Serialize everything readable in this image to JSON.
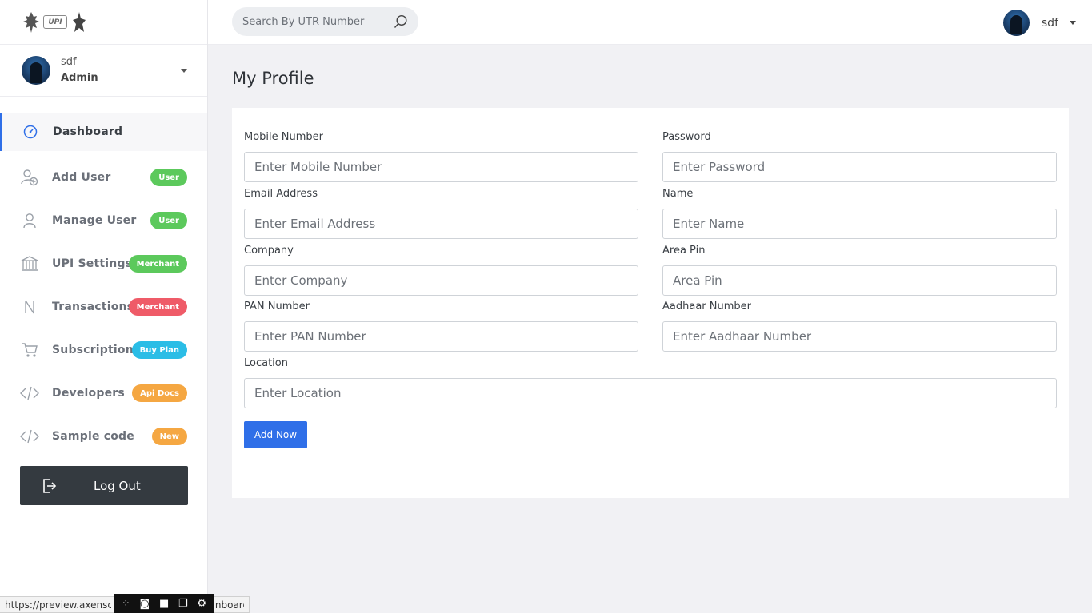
{
  "sidebar": {
    "user": {
      "name": "sdf",
      "role": "Admin"
    },
    "items": [
      {
        "label": "Dashboard",
        "icon": "gauge-icon",
        "badge": "",
        "badge_color": ""
      },
      {
        "label": "Add User",
        "icon": "add-user-icon",
        "badge": "User",
        "badge_color": "#5cc95c"
      },
      {
        "label": "Manage User",
        "icon": "user-icon",
        "badge": "User",
        "badge_color": "#5cc95c"
      },
      {
        "label": "UPI Settings",
        "icon": "bank-icon",
        "badge": "Merchant",
        "badge_color": "#5cc95c"
      },
      {
        "label": "Transactions",
        "icon": "rupee-icon",
        "badge": "Merchant",
        "badge_color": "#ef5b68"
      },
      {
        "label": "Subscription",
        "icon": "cart-icon",
        "badge": "Buy Plan",
        "badge_color": "#2bbde6"
      },
      {
        "label": "Developers",
        "icon": "code-icon",
        "badge": "Api Docs",
        "badge_color": "#f5a742"
      },
      {
        "label": "Sample code",
        "icon": "code-icon",
        "badge": "New",
        "badge_color": "#f5a742"
      }
    ],
    "logout_label": "Log Out"
  },
  "header": {
    "search_placeholder": "Search By UTR Number",
    "user_name": "sdf"
  },
  "main": {
    "title": "My Profile",
    "fields": {
      "mobile": {
        "label": "Mobile Number",
        "placeholder": "Enter Mobile Number"
      },
      "password": {
        "label": "Password",
        "placeholder": "Enter Password"
      },
      "email": {
        "label": "Email Address",
        "placeholder": "Enter Email Address"
      },
      "name": {
        "label": "Name",
        "placeholder": "Enter Name"
      },
      "company": {
        "label": "Company",
        "placeholder": "Enter Company"
      },
      "area_pin": {
        "label": "Area Pin",
        "placeholder": "Area Pin"
      },
      "pan": {
        "label": "PAN Number",
        "placeholder": "Enter PAN Number"
      },
      "aadhaar": {
        "label": "Aadhaar Number",
        "placeholder": "Enter Aadhaar Number"
      },
      "location": {
        "label": "Location",
        "placeholder": "Enter Location"
      }
    },
    "submit_label": "Add Now"
  },
  "statusbar": {
    "url_left": "https://preview.axenscript",
    "url_right": "nboard"
  },
  "colors": {
    "accent": "#2f6fe8",
    "logout_bg": "#343a40"
  }
}
